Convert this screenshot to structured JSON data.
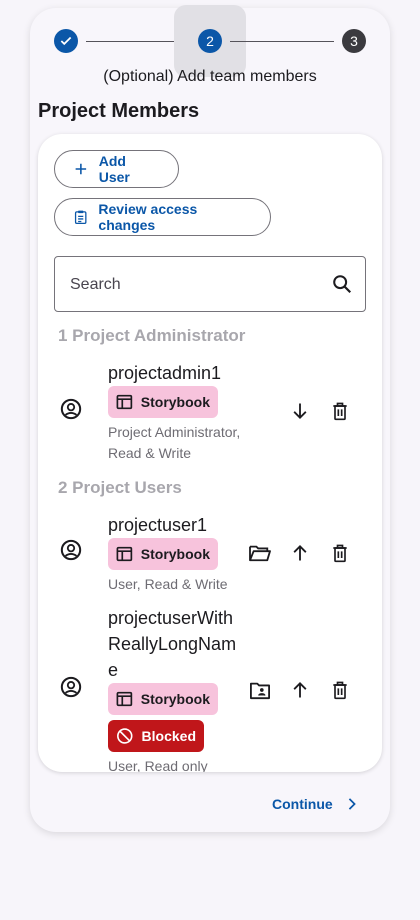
{
  "stepper": {
    "steps": [
      "",
      "2",
      "3"
    ],
    "caption": "(Optional) Add team members",
    "colors": {
      "done": "#0b57a8",
      "active": "#0b57a8",
      "pending": "#3b3a3f"
    }
  },
  "section_title": "Project Members",
  "buttons": {
    "add_user": "Add User",
    "review_access": "Review access changes",
    "continue": "Continue"
  },
  "search": {
    "placeholder": "Search"
  },
  "groups": {
    "admins": {
      "title": "1 Project Administrator"
    },
    "users": {
      "title": "2 Project Users"
    }
  },
  "members": [
    {
      "name": "projectadmin1",
      "chip": "Storybook",
      "role_lines": [
        "Project Administrator,",
        "Read & Write"
      ],
      "actions": [
        "arrow-down-icon",
        "delete-icon"
      ]
    },
    {
      "name": "projectuser1",
      "chip": "Storybook",
      "role_lines": [
        "User, Read & Write"
      ],
      "actions": [
        "folder-open-icon",
        "arrow-up-icon",
        "delete-icon"
      ]
    },
    {
      "name_lines": [
        "projectuserWith",
        "ReallyLongNam",
        "e"
      ],
      "chip": "Storybook",
      "blocked": "Blocked",
      "role_lines": [
        "User, Read only"
      ],
      "actions": [
        "folder-shared-icon",
        "arrow-up-icon",
        "delete-icon"
      ]
    }
  ],
  "colors": {
    "accent": "#0b57a8",
    "storybook_chip": "#f7c3dc",
    "blocked_chip": "#c0161a"
  }
}
